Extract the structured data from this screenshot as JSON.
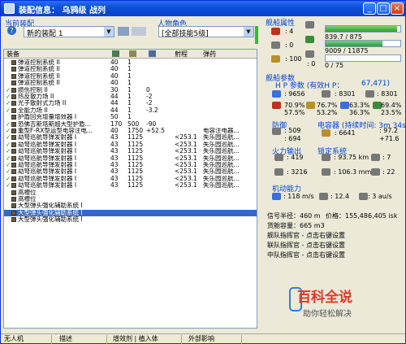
{
  "window": {
    "title": "装配信息： 乌鸦级 战列"
  },
  "config": {
    "label": "当前装配",
    "help": "?",
    "value": "新的装配 1"
  },
  "character": {
    "label": "人物角色",
    "value": "[全部技能5级]"
  },
  "list_header": {
    "name": "装备",
    "col_range": "射程",
    "col_ammo": "弹药"
  },
  "modules": [
    {
      "check": "",
      "name": "弹道控制系统 II",
      "c1": "40",
      "c2": "1",
      "c3": "",
      "c4": "",
      "c5": ""
    },
    {
      "check": "",
      "name": "弹道控制系统 II",
      "c1": "40",
      "c2": "1",
      "c3": "",
      "c4": "",
      "c5": ""
    },
    {
      "check": "",
      "name": "弹道控制系统 II",
      "c1": "40",
      "c2": "1",
      "c3": "",
      "c4": "",
      "c5": ""
    },
    {
      "check": "",
      "name": "弹道控制系统 II",
      "c1": "40",
      "c2": "1",
      "c3": "",
      "c4": "",
      "c5": ""
    },
    {
      "check": "✓",
      "name": "损伤控制 II",
      "c1": "30",
      "c2": "1",
      "c3": "0",
      "c4": "",
      "c5": ""
    },
    {
      "check": "✓",
      "name": "热反散力场 II",
      "c1": "44",
      "c2": "1",
      "c3": "-2",
      "c4": "",
      "c5": ""
    },
    {
      "check": "✓",
      "name": "光子散射式力场 II",
      "c1": "44",
      "c2": "1",
      "c3": "-2",
      "c4": "",
      "c5": ""
    },
    {
      "check": "✓",
      "name": "全能力场 II",
      "c1": "44",
      "c2": "1",
      "c3": "-3.2",
      "c4": "",
      "c5": ""
    },
    {
      "check": "",
      "name": "护盾回充增量增效器 I",
      "c1": "50",
      "c2": "1",
      "c3": "",
      "c4": "",
      "c5": ""
    },
    {
      "check": "✓",
      "name": "恐佛吉斯塔斯超大型护盾...",
      "c1": "170",
      "c2": "500",
      "c3": "-90",
      "c4": "",
      "c5": ""
    },
    {
      "check": "✓",
      "name": "重型F-RX型运型电容注电...",
      "c1": "40",
      "c2": "1750",
      "c3": "+52.5",
      "c4": "",
      "c5": "电容注电器..."
    },
    {
      "check": "✓",
      "name": "劫弩巡航导弹发射器 I",
      "c1": "43",
      "c2": "1125",
      "c3": "",
      "c4": "<253.1",
      "c5": "失乐园巡航..."
    },
    {
      "check": "✓",
      "name": "劫弩巡航导弹发射器 I",
      "c1": "43",
      "c2": "1125",
      "c3": "",
      "c4": "<253.1",
      "c5": "失乐园巡航..."
    },
    {
      "check": "✓",
      "name": "劫弩巡航导弹发射器 I",
      "c1": "43",
      "c2": "1125",
      "c3": "",
      "c4": "<253.1",
      "c5": "失乐园巡航..."
    },
    {
      "check": "✓",
      "name": "劫弩巡航导弹发射器 I",
      "c1": "43",
      "c2": "1125",
      "c3": "",
      "c4": "<253.1",
      "c5": "失乐园巡航..."
    },
    {
      "check": "✓",
      "name": "劫弩巡航导弹发射器 I",
      "c1": "43",
      "c2": "1125",
      "c3": "",
      "c4": "<253.1",
      "c5": "失乐园巡航..."
    },
    {
      "check": "✓",
      "name": "劫弩巡航导弹发射器 I",
      "c1": "43",
      "c2": "1125",
      "c3": "",
      "c4": "<253.1",
      "c5": "失乐园巡航..."
    },
    {
      "check": "✓",
      "name": "劫弩巡航导弹发射器 I",
      "c1": "43",
      "c2": "1125",
      "c3": "",
      "c4": "<253.1",
      "c5": "失乐园巡航..."
    },
    {
      "check": "✓",
      "name": "劫弩巡航导弹发射器 I",
      "c1": "43",
      "c2": "1125",
      "c3": "",
      "c4": "<253.1",
      "c5": "失乐园巡航..."
    },
    {
      "check": "",
      "name": "高槽位",
      "c1": "",
      "c2": "",
      "c3": "",
      "c4": "",
      "c5": ""
    },
    {
      "check": "",
      "name": "高槽位",
      "c1": "",
      "c2": "",
      "c3": "",
      "c4": "",
      "c5": ""
    },
    {
      "check": "",
      "name": "大型弹头强化辅助系统 I",
      "c1": "",
      "c2": "",
      "c3": "",
      "c4": "",
      "c5": ""
    },
    {
      "check": "",
      "name": "大型弹头强化辅助系统 I",
      "c1": "",
      "c2": "",
      "c3": "",
      "c4": "",
      "c5": ""
    },
    {
      "check": "",
      "name": "大型弹头强化辅助系统 I",
      "c1": "",
      "c2": "",
      "c3": "",
      "c4": "",
      "c5": ""
    }
  ],
  "ship_attrs": {
    "label": "舰船属性",
    "slots_high": ": 4",
    "slots_mid": ": 0",
    "slots_low": ": 100",
    "cpu": "839.7 / 875",
    "cpu_fraction": 0.96,
    "power": "9009 / 11875",
    "power_fraction": 0.76,
    "calibration": "0 / 75",
    "calibration_fraction": 0,
    "calib_extra": ": 0"
  },
  "ship_params": {
    "label": "舰船参数",
    "ehp_label": "H P 参数 (有效H P：",
    "ehp_value": "67,471)",
    "hp_shield": ": 9656",
    "hp_armor": ": 8301",
    "hp_struct": ": 8301",
    "res": [
      {
        "a": "70.9%",
        "b": "57.5%"
      },
      {
        "a": "76.7%",
        "b": "53.2%"
      },
      {
        "a": "63.3%",
        "b": "36.3%"
      },
      {
        "a": "69.4%",
        "b": "23.5%"
      }
    ]
  },
  "defense": {
    "label": "防御",
    "v1": ": 509",
    "v2": ": 694"
  },
  "capacitor": {
    "label": "电容器 (持续时间: 3m 34s)",
    "v1": ": 6641",
    "v2": ": 97.2",
    "v3": "+71.6"
  },
  "firepower": {
    "label": "火力输出",
    "v1": ": 419",
    "v2": ": 3216"
  },
  "targeting": {
    "label": "锁定系统",
    "v1": ": 93.75 km",
    "v2": ": 7",
    "v3": ": 106.3 mm",
    "v4": ": 22"
  },
  "mobility": {
    "label": "机动能力",
    "v1": ": 118 m/s",
    "v2": ": 12.4",
    "v3": ": 3 au/s"
  },
  "signature": {
    "text1": "信号半径：460 m",
    "text2": "价格：155,486,405 isk"
  },
  "cargo": "货舱容量：665 m3",
  "fleet": [
    "舰队指挥官 - 点击右键设置",
    "联队指挥官 - 点击右键设置",
    "中队指挥官 - 点击右键设置"
  ],
  "statusbar": {
    "s1": "无人机",
    "s2": "描述",
    "s3": "增效剂 | 植入体",
    "s4": "外部影响"
  },
  "watermark": {
    "t1": "百科全说",
    "t2": "助你轻松解决"
  }
}
